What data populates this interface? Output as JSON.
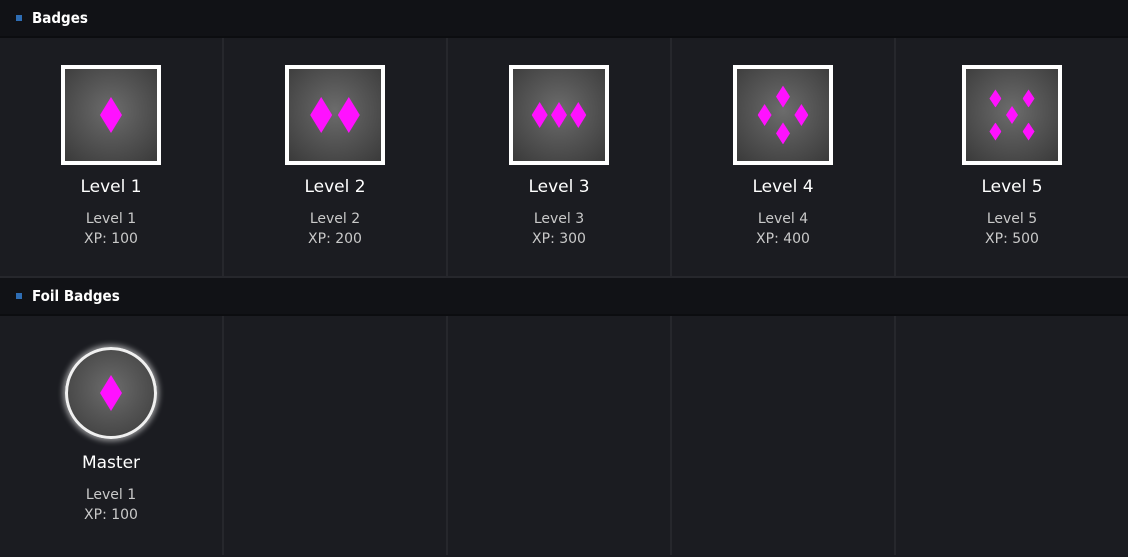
{
  "badges_section": {
    "title": "Badges"
  },
  "badges": [
    {
      "name": "Level 1",
      "level": "Level 1",
      "xp": "XP: 100",
      "icon": "one-diamond-icon"
    },
    {
      "name": "Level 2",
      "level": "Level 2",
      "xp": "XP: 200",
      "icon": "two-diamonds-icon"
    },
    {
      "name": "Level 3",
      "level": "Level 3",
      "xp": "XP: 300",
      "icon": "three-diamonds-icon"
    },
    {
      "name": "Level 4",
      "level": "Level 4",
      "xp": "XP: 400",
      "icon": "four-diamonds-icon"
    },
    {
      "name": "Level 5",
      "level": "Level 5",
      "xp": "XP: 500",
      "icon": "five-diamonds-icon"
    }
  ],
  "foil_section": {
    "title": "Foil Badges"
  },
  "foil_badges": [
    {
      "name": "Master",
      "level": "Level 1",
      "xp": "XP: 100",
      "icon": "foil-diamond-icon"
    }
  ],
  "colors": {
    "accent": "#ff11ff",
    "marker": "#2e6db4",
    "background": "#1a1b20"
  }
}
